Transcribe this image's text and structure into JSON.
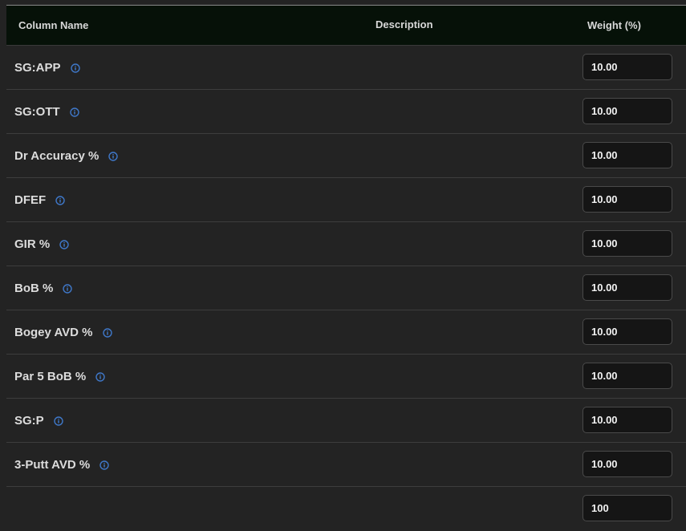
{
  "header": {
    "column_name": "Column Name",
    "description": "Description",
    "weight": "Weight (%)"
  },
  "rows": [
    {
      "label": "SG:APP",
      "weight": "10.00",
      "icon": "info-icon"
    },
    {
      "label": "SG:OTT",
      "weight": "10.00",
      "icon": "info-icon"
    },
    {
      "label": "Dr Accuracy %",
      "weight": "10.00",
      "icon": "info-icon"
    },
    {
      "label": "DFEF",
      "weight": "10.00",
      "icon": "info-icon"
    },
    {
      "label": "GIR %",
      "weight": "10.00",
      "icon": "info-icon"
    },
    {
      "label": "BoB %",
      "weight": "10.00",
      "icon": "info-icon"
    },
    {
      "label": "Bogey AVD %",
      "weight": "10.00",
      "icon": "info-icon"
    },
    {
      "label": "Par 5 BoB %",
      "weight": "10.00",
      "icon": "info-icon"
    },
    {
      "label": "SG:P",
      "weight": "10.00",
      "icon": "info-icon"
    },
    {
      "label": "3-Putt AVD %",
      "weight": "10.00",
      "icon": "info-icon"
    }
  ],
  "total": {
    "weight": "100"
  },
  "colors": {
    "header_bg": "#061108",
    "page_bg": "#232323",
    "input_bg": "#151515",
    "info_icon": "#3f78c9"
  }
}
